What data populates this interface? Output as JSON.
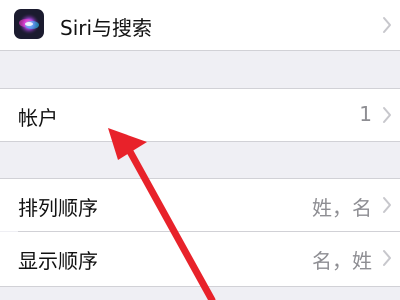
{
  "settings": {
    "siri_row": {
      "label": "Siri与搜索",
      "icon": "siri-icon"
    },
    "accounts_row": {
      "label": "帐户",
      "value": "1"
    },
    "sort_order_row": {
      "label": "排列顺序",
      "value": "姓，名"
    },
    "display_order_row": {
      "label": "显示顺序",
      "value": "名，姓"
    }
  },
  "colors": {
    "background": "#efeff4",
    "row_background": "#ffffff",
    "separator": "#d1d1d6",
    "detail_text": "#8e8e93",
    "annotation_arrow": "#e8222a"
  }
}
